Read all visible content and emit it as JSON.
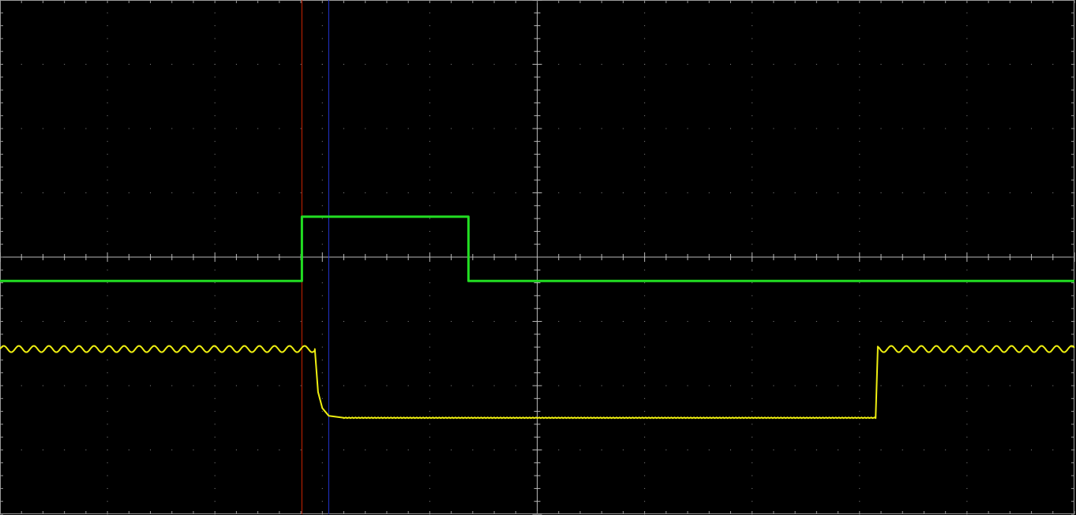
{
  "chart_data": {
    "type": "line",
    "x_range": [
      0,
      10
    ],
    "y_range": [
      -4,
      4
    ],
    "divisions": {
      "x": 10,
      "y": 8,
      "minor_per_division": 5
    },
    "grid": true,
    "cursors": [
      {
        "name": "cursor-a",
        "x": 2.81,
        "color": "#cc2200"
      },
      {
        "name": "cursor-b",
        "x": 3.06,
        "color": "#2233cc"
      }
    ],
    "series": [
      {
        "color": "#22dd22",
        "points": [
          [
            0,
            -0.37
          ],
          [
            2.81,
            -0.37
          ],
          [
            2.81,
            0.63
          ],
          [
            4.36,
            0.63
          ],
          [
            4.36,
            -0.37
          ],
          [
            10,
            -0.37
          ]
        ]
      },
      {
        "color": "#eeee11",
        "ripple": {
          "amplitude": 0.05,
          "period": 0.14
        },
        "points": [
          [
            0,
            -1.43
          ],
          [
            2.93,
            -1.43
          ],
          [
            2.96,
            -2.1
          ],
          [
            3.0,
            -2.35
          ],
          [
            3.06,
            -2.47
          ],
          [
            3.2,
            -2.5
          ],
          [
            8.15,
            -2.5
          ],
          [
            8.17,
            -1.43
          ],
          [
            10,
            -1.43
          ]
        ]
      }
    ]
  }
}
